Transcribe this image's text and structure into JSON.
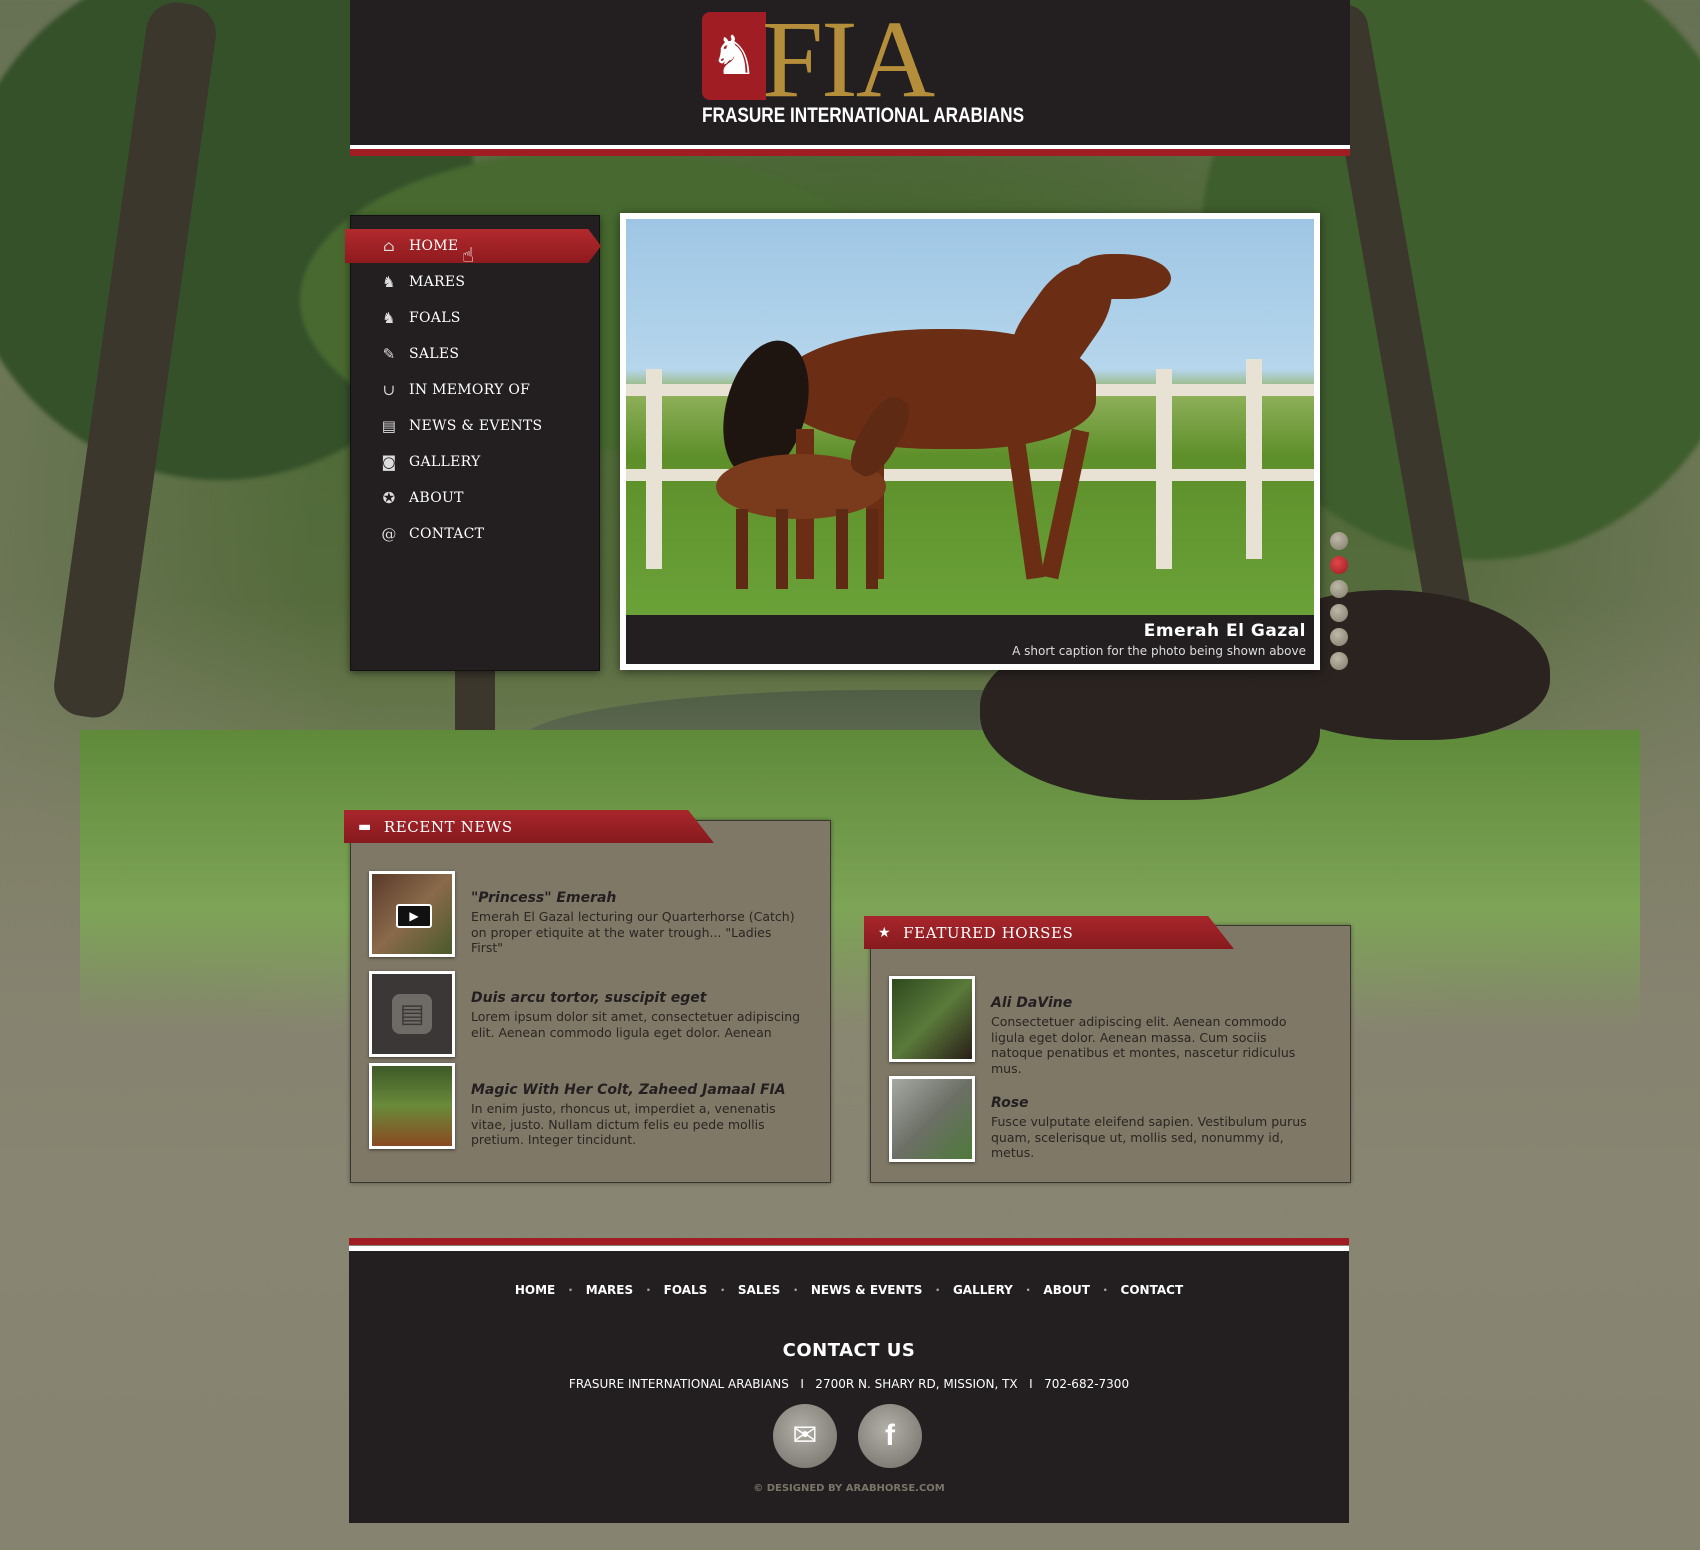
{
  "header": {
    "logo_mark": "♞",
    "logo_text": "FIA",
    "logo_subtitle": "FRASURE INTERNATIONAL ARABIANS"
  },
  "nav": {
    "items": [
      {
        "label": "HOME",
        "icon": "⌂",
        "icon_name": "home-icon"
      },
      {
        "label": "MARES",
        "icon": "♞",
        "icon_name": "horse-head-icon"
      },
      {
        "label": "FOALS",
        "icon": "♞",
        "icon_name": "foal-icon"
      },
      {
        "label": "SALES",
        "icon": "✎",
        "icon_name": "tag-icon"
      },
      {
        "label": "IN MEMORY OF",
        "icon": "∪",
        "icon_name": "horseshoe-icon"
      },
      {
        "label": "NEWS & EVENTS",
        "icon": "▤",
        "icon_name": "newspaper-icon"
      },
      {
        "label": "GALLERY",
        "icon": "◙",
        "icon_name": "camera-icon"
      },
      {
        "label": "ABOUT",
        "icon": "✪",
        "icon_name": "star-badge-icon"
      },
      {
        "label": "CONTACT",
        "icon": "@",
        "icon_name": "at-sign-icon"
      }
    ],
    "active": "HOME"
  },
  "slider": {
    "title": "Emerah El Gazal",
    "caption": "A short caption for the photo being shown above",
    "dots": 6,
    "active_dot": 2
  },
  "recent_news": {
    "heading": "RECENT NEWS",
    "icon": "▬",
    "items": [
      {
        "title": "\"Princess\" Emerah",
        "text": "Emerah El Gazal lecturing our Quarterhorse (Catch) on proper etiquite at the water trough... \"Ladies First\"",
        "thumb": "video"
      },
      {
        "title": "Duis arcu tortor, suscipit eget",
        "text": "Lorem ipsum dolor sit amet, consectetuer adipiscing elit. Aenean commodo ligula eget dolor. Aenean",
        "thumb": "news"
      },
      {
        "title": "Magic With Her Colt, Zaheed Jamaal FIA",
        "text": "In enim justo, rhoncus ut, imperdiet a, venenatis vitae, justo. Nullam dictum felis eu pede mollis pretium. Integer tincidunt.",
        "thumb": "photo"
      }
    ]
  },
  "featured": {
    "heading": "FEATURED HORSES",
    "icon": "★",
    "items": [
      {
        "title": "Ali DaVine",
        "text": "Consectetuer adipiscing elit. Aenean commodo ligula eget dolor. Aenean massa. Cum sociis natoque penatibus et montes, nascetur ridiculus mus."
      },
      {
        "title": "Rose",
        "text": "Fusce vulputate eleifend sapien. Vestibulum purus quam, scelerisque ut, mollis sed, nonummy id, metus."
      }
    ]
  },
  "footer": {
    "nav": [
      "HOME",
      "MARES",
      "FOALS",
      "SALES",
      "NEWS & EVENTS",
      "GALLERY",
      "ABOUT",
      "CONTACT"
    ],
    "contact_title": "CONTACT US",
    "contact_line": "FRASURE INTERNATIONAL ARABIANS   I   2700R N. SHARY RD, MISSION, TX   I   702-682-7300",
    "credit": "© DESIGNED BY ARABHORSE.COM"
  },
  "colors": {
    "accent_red": "#a01e23",
    "gold": "#b48e3a",
    "dark": "#231f20",
    "panel": "#7f7867"
  }
}
